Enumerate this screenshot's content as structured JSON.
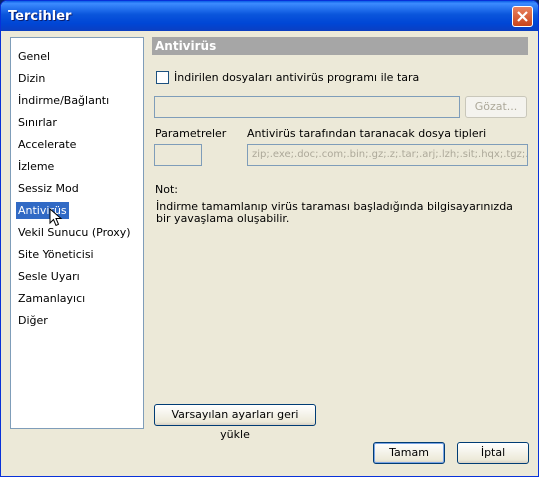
{
  "window": {
    "title": "Tercihler"
  },
  "nav": {
    "items": [
      {
        "label": "Genel"
      },
      {
        "label": "Dizin"
      },
      {
        "label": "İndirme/Bağlantı"
      },
      {
        "label": "Sınırlar"
      },
      {
        "label": "Accelerate"
      },
      {
        "label": "İzleme"
      },
      {
        "label": "Sessiz Mod"
      },
      {
        "label": "Antivirüs",
        "selected": true
      },
      {
        "label": "Vekil Sunucu (Proxy)"
      },
      {
        "label": "Site Yöneticisi"
      },
      {
        "label": "Sesle Uyarı"
      },
      {
        "label": "Zamanlayıcı"
      },
      {
        "label": "Diğer"
      }
    ]
  },
  "section": {
    "title": "Antivirüs",
    "scan_checkbox_label": "İndirilen dosyaları antivirüs programı ile tara",
    "scan_checked": false,
    "program_path": "",
    "browse_label": "Gözat...",
    "params_label": "Parametreler",
    "params_value": "",
    "filetypes_label": "Antivirüs tarafından taranacak dosya tipleri",
    "filetypes_value": "zip;.exe;.doc;.com;.bin;.gz;.z;.tar;.arj;.lzh;.sit;.hqx;.tgz;.dll;.",
    "note_label": "Not:",
    "note_text": "İndirme tamamlanıp virüs taraması başladığında bilgisayarınızda bir yavaşlama oluşabilir.",
    "reset_label": "Varsayılan ayarları geri yükle"
  },
  "footer": {
    "ok_label": "Tamam",
    "cancel_label": "İptal"
  },
  "colors": {
    "selection": "#316ac5",
    "section_header": "#a6a6a6",
    "window_bg": "#ece9d8"
  }
}
